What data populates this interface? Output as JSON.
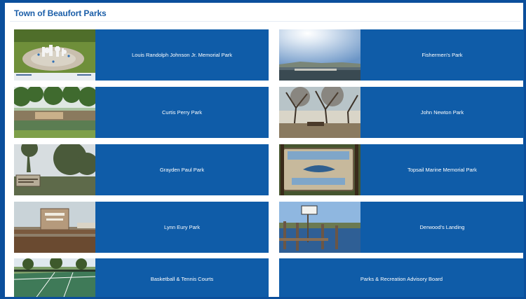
{
  "page": {
    "title": "Town of Beaufort Parks"
  },
  "parks": [
    {
      "label": "Louis Randolph Johnson Jr. Memorial Park",
      "thumbnail": "splash-pad-photo"
    },
    {
      "label": "Fishermen's Park",
      "thumbnail": "waterfront-sun-photo"
    },
    {
      "label": "Curtis Perry Park",
      "thumbnail": "waterfront-trees-photo"
    },
    {
      "label": "John Newton Park",
      "thumbnail": "shaded-park-photo"
    },
    {
      "label": "Grayden Paul Park",
      "thumbnail": "park-sign-photo"
    },
    {
      "label": "Topsail Marine Memorial Park",
      "thumbnail": "marine-sign-photo"
    },
    {
      "label": "Lynn Eury Park",
      "thumbnail": "brick-sign-photo"
    },
    {
      "label": "Derwood's Landing",
      "thumbnail": "dock-photo"
    },
    {
      "label": "Basketball & Tennis Courts",
      "thumbnail": "tennis-court-photo"
    },
    {
      "label": "Parks & Recreation Advisory Board",
      "thumbnail": ""
    }
  ],
  "colors": {
    "accent": "#0b4f9c",
    "card": "#0f5ca8",
    "title": "#1b5ea8"
  }
}
